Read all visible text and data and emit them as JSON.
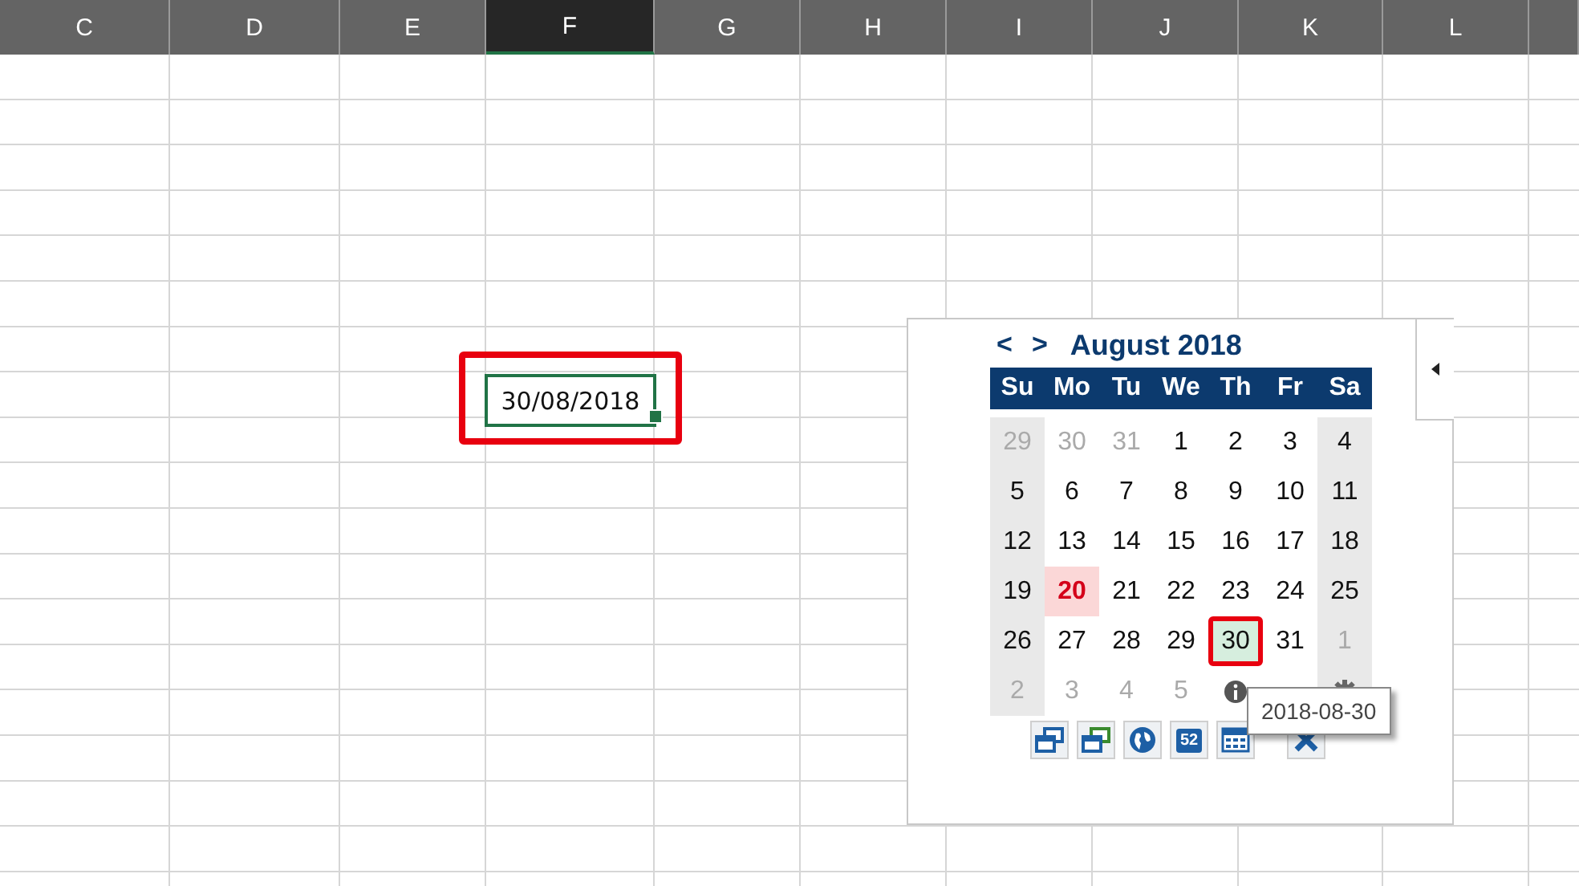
{
  "columns": [
    {
      "label": "C",
      "selected": false
    },
    {
      "label": "D",
      "selected": false
    },
    {
      "label": "E",
      "selected": false
    },
    {
      "label": "F",
      "selected": true
    },
    {
      "label": "G",
      "selected": false
    },
    {
      "label": "H",
      "selected": false
    },
    {
      "label": "I",
      "selected": false
    },
    {
      "label": "J",
      "selected": false
    },
    {
      "label": "K",
      "selected": false
    },
    {
      "label": "L",
      "selected": false
    }
  ],
  "active_cell": {
    "value": "30/08/2018",
    "highlighted": true
  },
  "calendar": {
    "prev": "<",
    "next": ">",
    "title": "August 2018",
    "weekdays": [
      "Su",
      "Mo",
      "Tu",
      "We",
      "Th",
      "Fr",
      "Sa"
    ],
    "weeks": [
      [
        {
          "day": "29",
          "in_month": false,
          "today": false,
          "selected": false
        },
        {
          "day": "30",
          "in_month": false,
          "today": false,
          "selected": false
        },
        {
          "day": "31",
          "in_month": false,
          "today": false,
          "selected": false
        },
        {
          "day": "1",
          "in_month": true,
          "today": false,
          "selected": false
        },
        {
          "day": "2",
          "in_month": true,
          "today": false,
          "selected": false
        },
        {
          "day": "3",
          "in_month": true,
          "today": false,
          "selected": false
        },
        {
          "day": "4",
          "in_month": true,
          "today": false,
          "selected": false
        }
      ],
      [
        {
          "day": "5",
          "in_month": true,
          "today": false,
          "selected": false
        },
        {
          "day": "6",
          "in_month": true,
          "today": false,
          "selected": false
        },
        {
          "day": "7",
          "in_month": true,
          "today": false,
          "selected": false
        },
        {
          "day": "8",
          "in_month": true,
          "today": false,
          "selected": false
        },
        {
          "day": "9",
          "in_month": true,
          "today": false,
          "selected": false
        },
        {
          "day": "10",
          "in_month": true,
          "today": false,
          "selected": false
        },
        {
          "day": "11",
          "in_month": true,
          "today": false,
          "selected": false
        }
      ],
      [
        {
          "day": "12",
          "in_month": true,
          "today": false,
          "selected": false
        },
        {
          "day": "13",
          "in_month": true,
          "today": false,
          "selected": false
        },
        {
          "day": "14",
          "in_month": true,
          "today": false,
          "selected": false
        },
        {
          "day": "15",
          "in_month": true,
          "today": false,
          "selected": false
        },
        {
          "day": "16",
          "in_month": true,
          "today": false,
          "selected": false
        },
        {
          "day": "17",
          "in_month": true,
          "today": false,
          "selected": false
        },
        {
          "day": "18",
          "in_month": true,
          "today": false,
          "selected": false
        }
      ],
      [
        {
          "day": "19",
          "in_month": true,
          "today": false,
          "selected": false
        },
        {
          "day": "20",
          "in_month": true,
          "today": true,
          "selected": false
        },
        {
          "day": "21",
          "in_month": true,
          "today": false,
          "selected": false
        },
        {
          "day": "22",
          "in_month": true,
          "today": false,
          "selected": false
        },
        {
          "day": "23",
          "in_month": true,
          "today": false,
          "selected": false
        },
        {
          "day": "24",
          "in_month": true,
          "today": false,
          "selected": false
        },
        {
          "day": "25",
          "in_month": true,
          "today": false,
          "selected": false
        }
      ],
      [
        {
          "day": "26",
          "in_month": true,
          "today": false,
          "selected": false
        },
        {
          "day": "27",
          "in_month": true,
          "today": false,
          "selected": false
        },
        {
          "day": "28",
          "in_month": true,
          "today": false,
          "selected": false
        },
        {
          "day": "29",
          "in_month": true,
          "today": false,
          "selected": false
        },
        {
          "day": "30",
          "in_month": true,
          "today": false,
          "selected": true
        },
        {
          "day": "31",
          "in_month": true,
          "today": false,
          "selected": false
        },
        {
          "day": "1",
          "in_month": false,
          "today": false,
          "selected": false
        }
      ],
      [
        {
          "day": "2",
          "in_month": false,
          "today": false,
          "selected": false
        },
        {
          "day": "3",
          "in_month": false,
          "today": false,
          "selected": false
        },
        {
          "day": "4",
          "in_month": false,
          "today": false,
          "selected": false
        },
        {
          "day": "5",
          "in_month": false,
          "today": false,
          "selected": false
        }
      ]
    ],
    "week_number_button": "52",
    "tooltip": "2018-08-30"
  }
}
